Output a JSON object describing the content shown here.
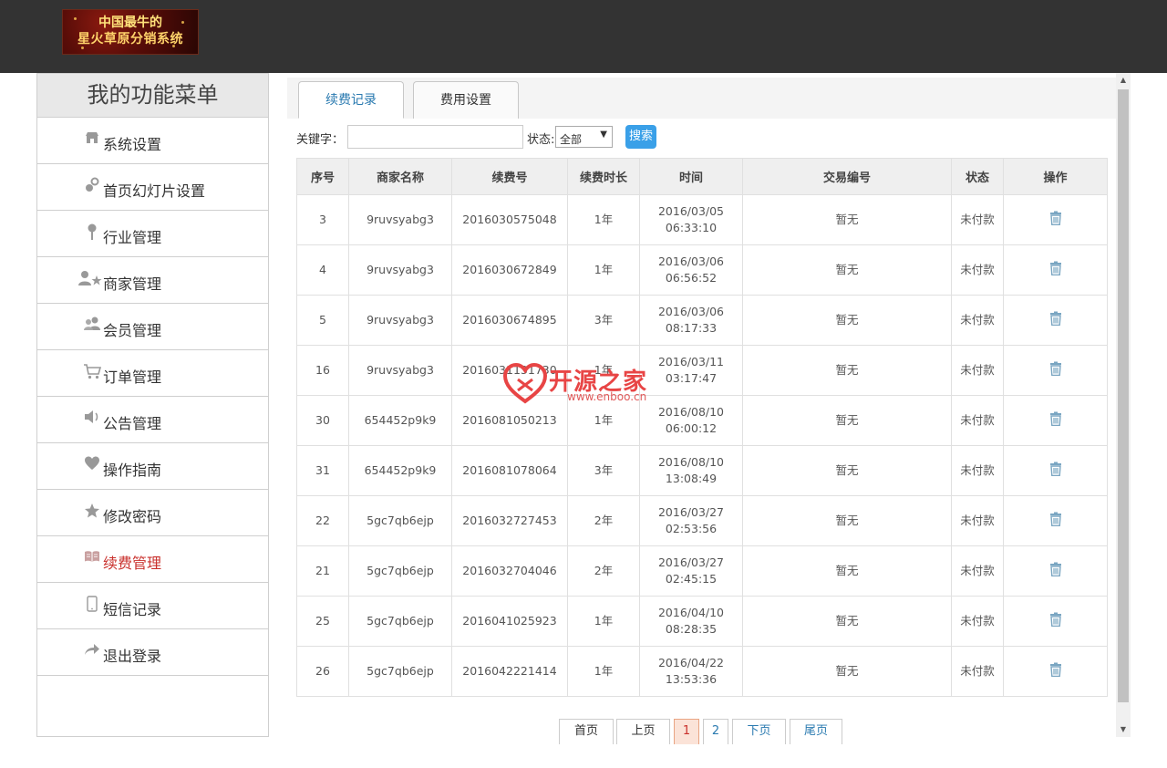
{
  "header": {
    "logo_line1": "中国最牛的",
    "logo_line2": "星火草原分销系统"
  },
  "sidebar": {
    "title": "我的功能菜单",
    "items": [
      {
        "label": "系统设置",
        "icon": "store-icon"
      },
      {
        "label": "首页幻灯片设置",
        "icon": "slideshow-icon"
      },
      {
        "label": "行业管理",
        "icon": "pin-icon"
      },
      {
        "label": "商家管理",
        "icon": "user-star-icon"
      },
      {
        "label": "会员管理",
        "icon": "users-icon"
      },
      {
        "label": "订单管理",
        "icon": "cart-icon"
      },
      {
        "label": "公告管理",
        "icon": "speaker-icon"
      },
      {
        "label": "操作指南",
        "icon": "heart-icon"
      },
      {
        "label": "修改密码",
        "icon": "star-icon"
      },
      {
        "label": "续费管理",
        "icon": "book-icon",
        "active": true
      },
      {
        "label": "短信记录",
        "icon": "phone-icon"
      },
      {
        "label": "退出登录",
        "icon": "share-arrow-icon"
      }
    ]
  },
  "tabs": [
    {
      "label": "续费记录",
      "active": true
    },
    {
      "label": "费用设置",
      "active": false
    }
  ],
  "filter": {
    "keyword_label": "关键字：",
    "keyword_value": "",
    "status_label": "状态:",
    "status_value": "全部",
    "search_label": "搜索"
  },
  "table": {
    "columns": [
      "序号",
      "商家名称",
      "续费号",
      "续费时长",
      "时间",
      "交易编号",
      "状态",
      "操作"
    ],
    "rows": [
      [
        "3",
        "9ruvsyabg3",
        "2016030575048",
        "1年",
        "2016/03/05",
        "06:33:10",
        "暂无",
        "未付款"
      ],
      [
        "4",
        "9ruvsyabg3",
        "2016030672849",
        "1年",
        "2016/03/06",
        "06:56:52",
        "暂无",
        "未付款"
      ],
      [
        "5",
        "9ruvsyabg3",
        "2016030674895",
        "3年",
        "2016/03/06",
        "08:17:33",
        "暂无",
        "未付款"
      ],
      [
        "16",
        "9ruvsyabg3",
        "2016031131730",
        "1年",
        "2016/03/11",
        "03:17:47",
        "暂无",
        "未付款"
      ],
      [
        "30",
        "654452p9k9",
        "2016081050213",
        "1年",
        "2016/08/10",
        "06:00:12",
        "暂无",
        "未付款"
      ],
      [
        "31",
        "654452p9k9",
        "2016081078064",
        "3年",
        "2016/08/10",
        "13:08:49",
        "暂无",
        "未付款"
      ],
      [
        "22",
        "5gc7qb6ejp",
        "2016032727453",
        "2年",
        "2016/03/27",
        "02:53:56",
        "暂无",
        "未付款"
      ],
      [
        "21",
        "5gc7qb6ejp",
        "2016032704046",
        "2年",
        "2016/03/27",
        "02:45:15",
        "暂无",
        "未付款"
      ],
      [
        "25",
        "5gc7qb6ejp",
        "2016041025923",
        "1年",
        "2016/04/10",
        "08:28:35",
        "暂无",
        "未付款"
      ],
      [
        "26",
        "5gc7qb6ejp",
        "2016042221414",
        "1年",
        "2016/04/22",
        "13:53:36",
        "暂无",
        "未付款"
      ]
    ]
  },
  "pager": {
    "first": "首页",
    "prev": "上页",
    "pages": [
      "1",
      "2"
    ],
    "current": "1",
    "next": "下页",
    "last": "尾页"
  },
  "watermark": {
    "text": "开源之家",
    "url": "www.enboo.cn"
  },
  "colors": {
    "topbar": "#333333",
    "active_menu": "#c9302c",
    "search_button": "#3aa0e8",
    "tab_active_text": "#2a7ab0",
    "action_icon": "#7aa6c2"
  }
}
